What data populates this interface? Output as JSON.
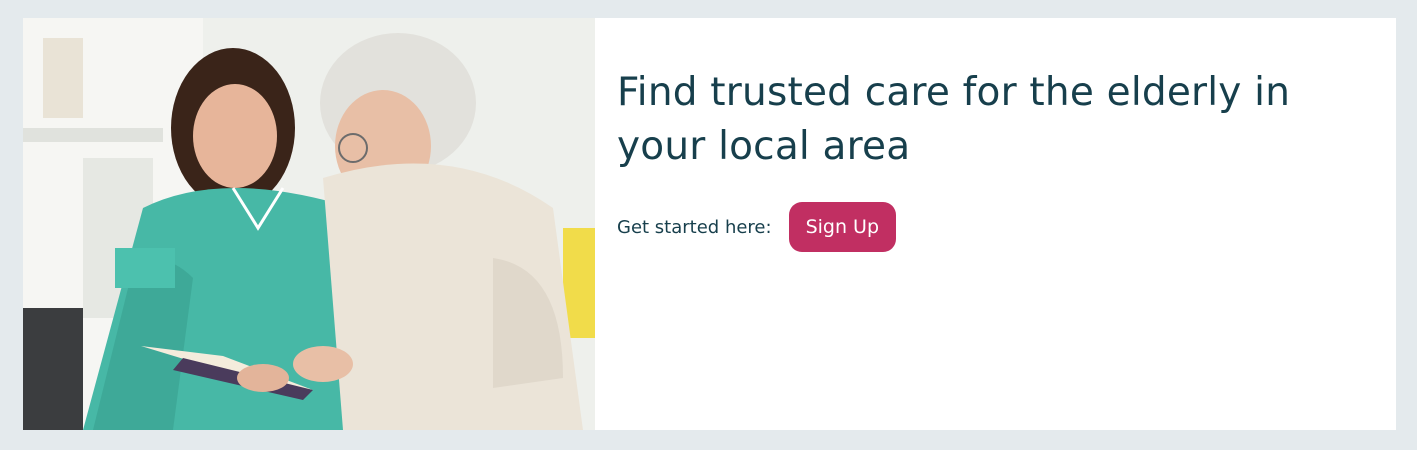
{
  "hero": {
    "image_alt": "Caregiver reading a book with an elderly woman",
    "headline": "Find trusted care for the elderly in your local area",
    "cta_label": "Get started here:",
    "signup_label": "Sign Up"
  },
  "colors": {
    "page_background": "#e4eaed",
    "headline_text": "#173f4c",
    "button_background": "#c12f62",
    "button_text": "#ffffff"
  }
}
